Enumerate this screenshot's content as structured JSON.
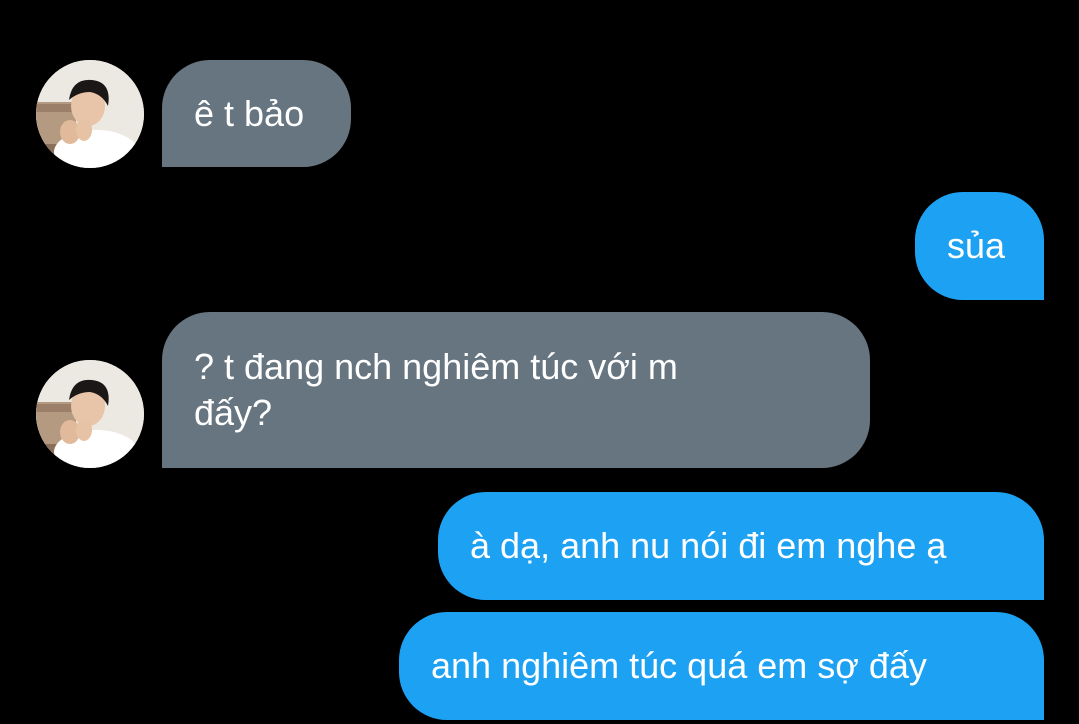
{
  "conversation": {
    "messages": [
      {
        "side": "incoming",
        "text": "ê t bảo",
        "avatar_icon": "profile-photo-icon"
      },
      {
        "side": "outgoing",
        "text": "sủa"
      },
      {
        "side": "incoming",
        "text": "? t đang nch nghiêm túc với m\nđấy?",
        "avatar_icon": "profile-photo-icon"
      },
      {
        "side": "outgoing",
        "text": "à dạ, anh nu nói đi em nghe ạ"
      },
      {
        "side": "outgoing",
        "text": "anh nghiêm túc quá em sợ đấy"
      }
    ]
  },
  "colors": {
    "background": "#000000",
    "incoming_bubble": "#66757f",
    "outgoing_bubble": "#1da1f2",
    "text": "#ffffff"
  }
}
